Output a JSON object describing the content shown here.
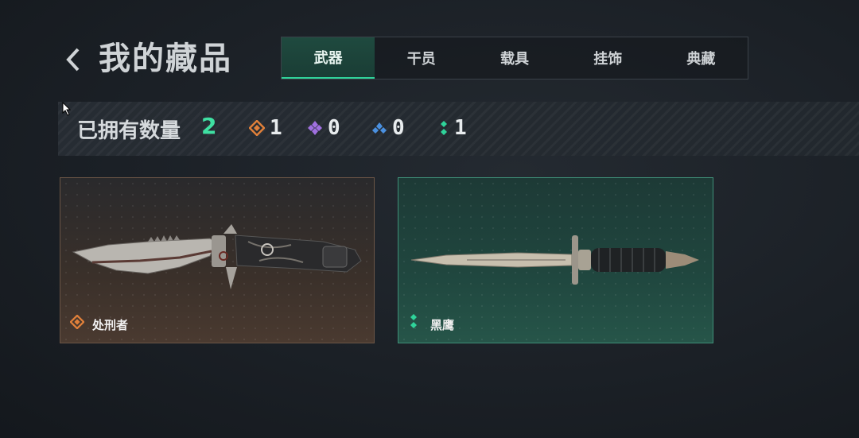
{
  "header": {
    "title": "我的藏品"
  },
  "tabs": [
    {
      "label": "武器",
      "active": true
    },
    {
      "label": "干员",
      "active": false
    },
    {
      "label": "载具",
      "active": false
    },
    {
      "label": "挂饰",
      "active": false
    },
    {
      "label": "典藏",
      "active": false
    }
  ],
  "stats": {
    "owned_label": "已拥有数量",
    "owned_total": "2",
    "rarities": [
      {
        "icon": "orange-diamond-icon",
        "color": "#e0803a",
        "count": "1"
      },
      {
        "icon": "purple-diamond-icon",
        "color": "#a070e0",
        "count": "0"
      },
      {
        "icon": "blue-diamond-icon",
        "color": "#4a90e0",
        "count": "0"
      },
      {
        "icon": "green-diamond-icon",
        "color": "#2fd39a",
        "count": "1"
      }
    ]
  },
  "items": [
    {
      "name": "处刑者",
      "rarity_color": "#e0803a",
      "icon": "orange-diamond-icon"
    },
    {
      "name": "黑鹰",
      "rarity_color": "#2fd39a",
      "icon": "green-diamond-icon"
    }
  ],
  "colors": {
    "accent": "#2fd39a",
    "background": "#1b2026"
  }
}
